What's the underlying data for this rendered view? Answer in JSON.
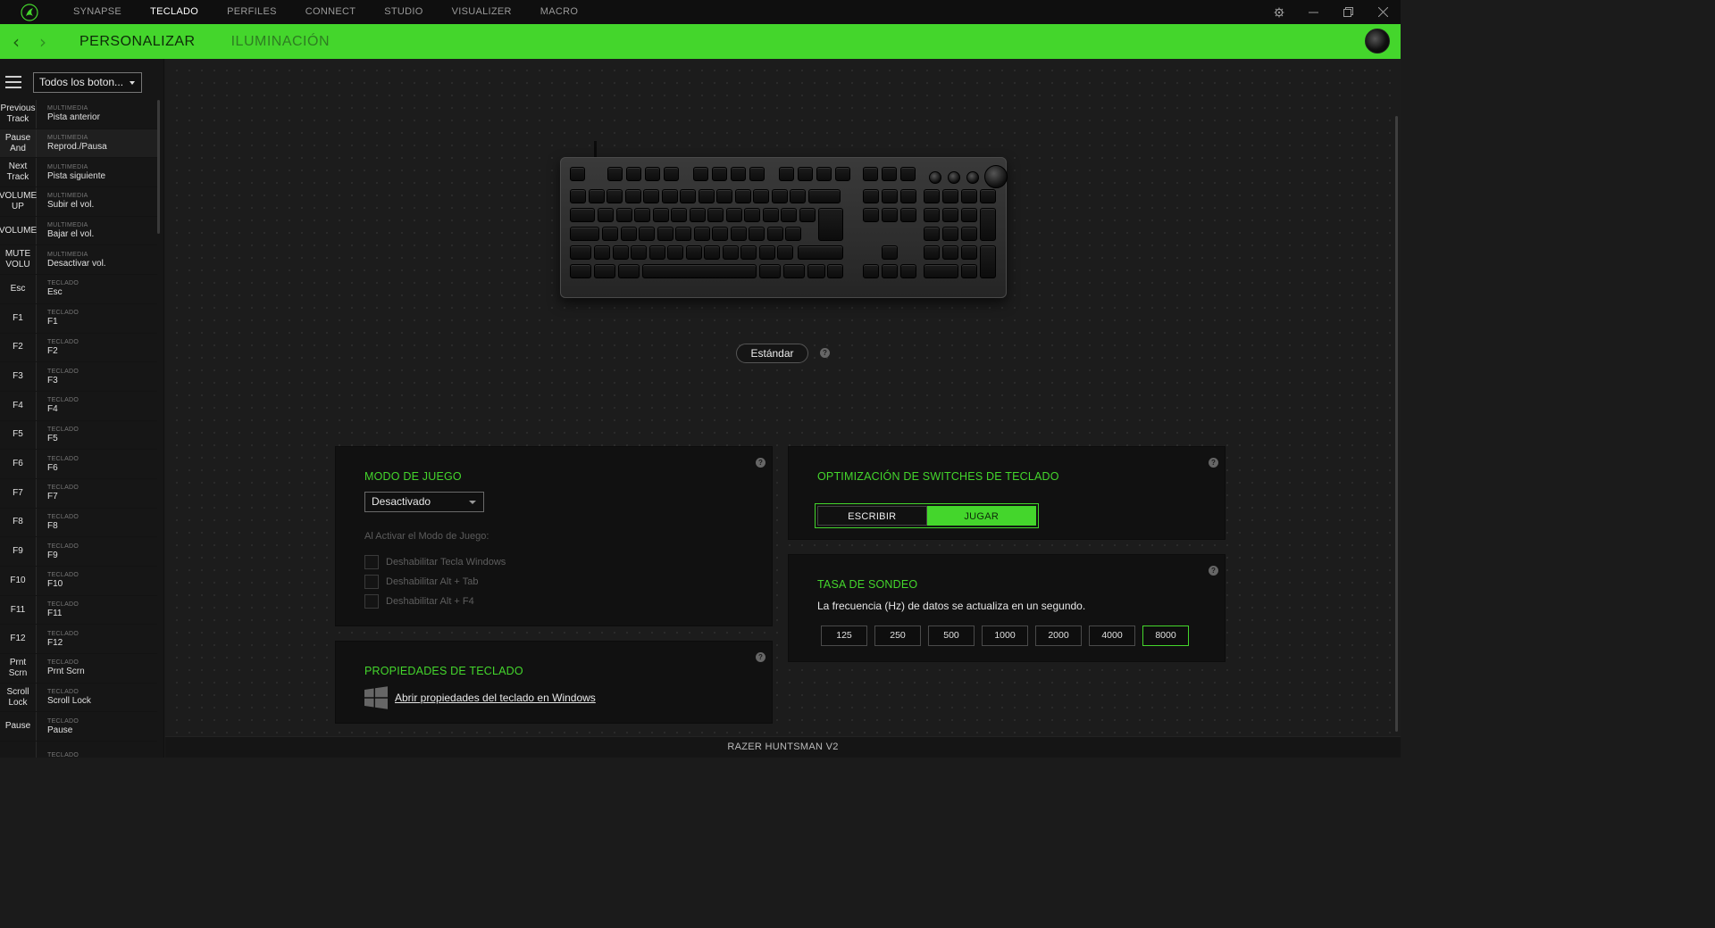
{
  "topnav": {
    "tabs": [
      {
        "label": "SYNAPSE",
        "active": false
      },
      {
        "label": "TECLADO",
        "active": true
      },
      {
        "label": "PERFILES",
        "active": false
      },
      {
        "label": "CONNECT",
        "active": false
      },
      {
        "label": "STUDIO",
        "active": false
      },
      {
        "label": "VISUALIZER",
        "active": false
      },
      {
        "label": "MACRO",
        "active": false
      }
    ],
    "icons": [
      "razer-logo-icon",
      "gear-icon",
      "minimize-icon",
      "restore-icon",
      "close-icon"
    ]
  },
  "greenbar": {
    "tabs": [
      {
        "label": "PERSONALIZAR",
        "active": true
      },
      {
        "label": "ILUMINACIÓN",
        "active": false
      }
    ],
    "accent": "#44d62c"
  },
  "sidebar": {
    "filter_value": "Todos los boton...",
    "items": [
      {
        "key": "Previous Track",
        "category": "MULTIMEDIA",
        "value": "Pista anterior"
      },
      {
        "key": "Pause And",
        "category": "MULTIMEDIA",
        "value": "Reprod./Pausa"
      },
      {
        "key": "Next Track",
        "category": "MULTIMEDIA",
        "value": "Pista siguiente"
      },
      {
        "key": "VOLUME UP",
        "category": "MULTIMEDIA",
        "value": "Subir el vol."
      },
      {
        "key": "VOLUME",
        "category": "MULTIMEDIA",
        "value": "Bajar el vol."
      },
      {
        "key": "MUTE VOLU",
        "category": "MULTIMEDIA",
        "value": "Desactivar vol."
      },
      {
        "key": "Esc",
        "category": "TECLADO",
        "value": "Esc"
      },
      {
        "key": "F1",
        "category": "TECLADO",
        "value": "F1"
      },
      {
        "key": "F2",
        "category": "TECLADO",
        "value": "F2"
      },
      {
        "key": "F3",
        "category": "TECLADO",
        "value": "F3"
      },
      {
        "key": "F4",
        "category": "TECLADO",
        "value": "F4"
      },
      {
        "key": "F5",
        "category": "TECLADO",
        "value": "F5"
      },
      {
        "key": "F6",
        "category": "TECLADO",
        "value": "F6"
      },
      {
        "key": "F7",
        "category": "TECLADO",
        "value": "F7"
      },
      {
        "key": "F8",
        "category": "TECLADO",
        "value": "F8"
      },
      {
        "key": "F9",
        "category": "TECLADO",
        "value": "F9"
      },
      {
        "key": "F10",
        "category": "TECLADO",
        "value": "F10"
      },
      {
        "key": "F11",
        "category": "TECLADO",
        "value": "F11"
      },
      {
        "key": "F12",
        "category": "TECLADO",
        "value": "F12"
      },
      {
        "key": "Prnt Scrn",
        "category": "TECLADO",
        "value": "Prnt Scrn"
      },
      {
        "key": "Scroll Lock",
        "category": "TECLADO",
        "value": "Scroll Lock"
      },
      {
        "key": "Pause",
        "category": "TECLADO",
        "value": "Pause"
      },
      {
        "key": "",
        "category": "TECLADO",
        "value": ""
      }
    ]
  },
  "main": {
    "mode_label": "Estándar",
    "game_mode": {
      "title": "MODO DE JUEGO",
      "selected": "Desactivado",
      "subtitle": "Al Activar el Modo de Juego:",
      "options": [
        "Deshabilitar Tecla Windows",
        "Deshabilitar Alt + Tab",
        "Deshabilitar Alt + F4"
      ]
    },
    "keyboard_props": {
      "title": "PROPIEDADES DE TECLADO",
      "link": "Abrir propiedades del teclado en Windows"
    },
    "switch_opt": {
      "title": "OPTIMIZACIÓN DE SWITCHES DE TECLADO",
      "options": [
        "ESCRIBIR",
        "JUGAR"
      ],
      "selected": "JUGAR"
    },
    "polling": {
      "title": "TASA DE SONDEO",
      "description": "La frecuencia (Hz) de datos se actualiza en un segundo.",
      "rates": [
        "125",
        "250",
        "500",
        "1000",
        "2000",
        "4000",
        "8000"
      ],
      "selected": "8000"
    }
  },
  "footer": {
    "device_name": "RAZER HUNTSMAN V2"
  }
}
